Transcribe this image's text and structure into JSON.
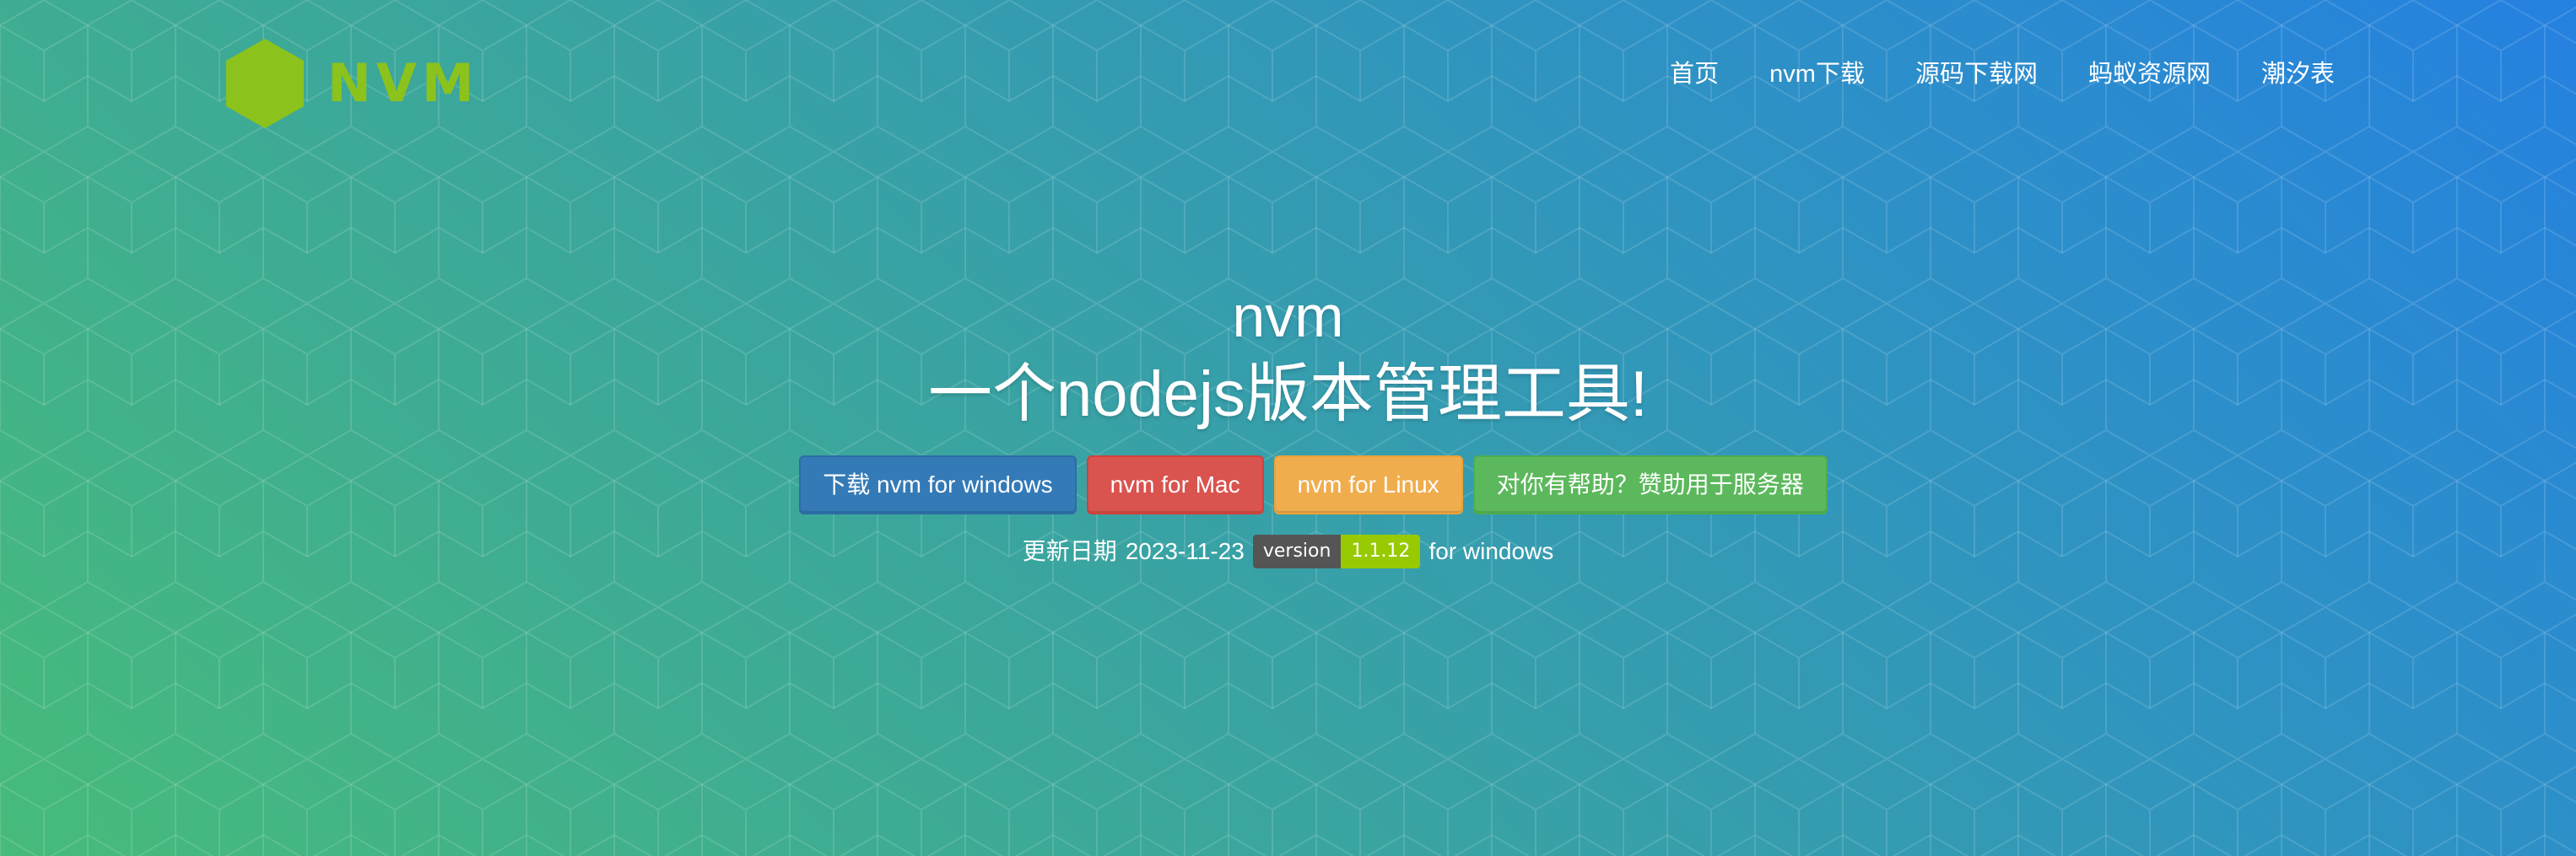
{
  "header": {
    "logo_text": "NVM",
    "logo_icon": "nodejs-hexagon-icon",
    "logo_color": "#8cc21c",
    "nav": [
      {
        "label": "首页"
      },
      {
        "label": "nvm下载"
      },
      {
        "label": "源码下载网"
      },
      {
        "label": "蚂蚁资源网"
      },
      {
        "label": "潮汐表"
      }
    ]
  },
  "hero": {
    "title": "nvm",
    "subtitle": "一个nodejs版本管理工具!",
    "buttons": [
      {
        "label": "下载 nvm for windows",
        "color": "#337ab7"
      },
      {
        "label": "nvm for Mac",
        "color": "#d9534f"
      },
      {
        "label": "nvm for Linux",
        "color": "#f0ad4e"
      },
      {
        "label": "对你有帮助？赞助用于服务器",
        "color": "#5cb85c"
      }
    ],
    "update": {
      "prefix": "更新日期",
      "date": "2023-11-23",
      "badge_label": "version",
      "badge_value": "1.1.12",
      "badge_value_color": "#97ca00",
      "suffix": "for windows"
    }
  },
  "theme": {
    "gradient_start": "#47bb7a",
    "gradient_end": "#2581e0"
  }
}
